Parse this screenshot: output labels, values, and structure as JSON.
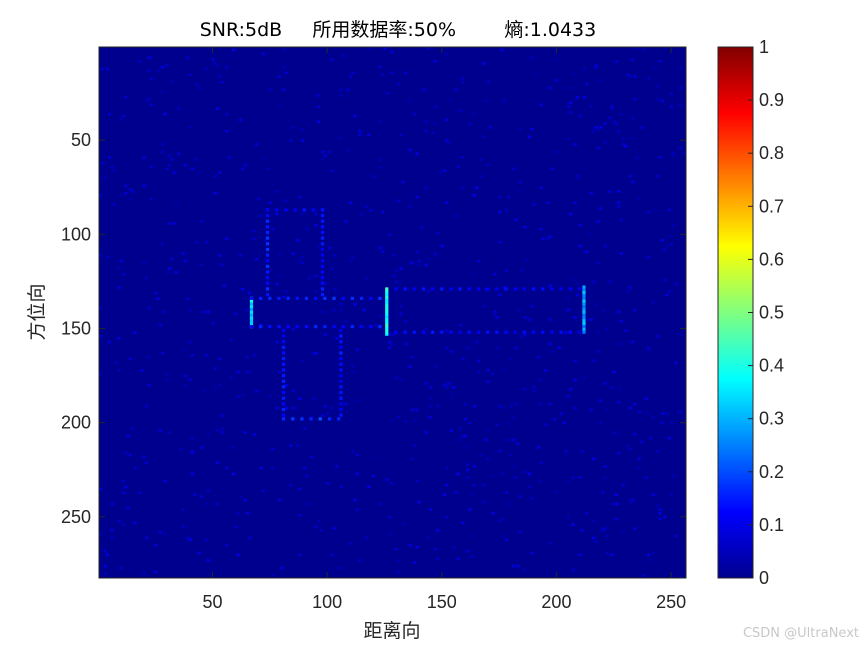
{
  "chart_data": {
    "type": "heatmap",
    "title": "SNR:5dB     所用数据率:50%        熵:1.0433",
    "xlabel": "距离向",
    "ylabel": "方位向",
    "xlim": [
      0.5,
      256.5
    ],
    "ylim": [
      0.5,
      282.5
    ],
    "y_reversed": true,
    "xticks": [
      50,
      100,
      150,
      200,
      250
    ],
    "yticks": [
      50,
      100,
      150,
      200,
      250
    ],
    "colormap": "jet",
    "background_color": "#00008f",
    "colorbar": {
      "range": [
        0,
        1
      ],
      "ticks": [
        0,
        0.1,
        0.2,
        0.3,
        0.4,
        0.5,
        0.6,
        0.7,
        0.8,
        0.9,
        1
      ]
    },
    "image_size": [
      256,
      282
    ],
    "scatterers": [
      {
        "x": 74,
        "y1": 87,
        "y2": 133,
        "value": 0.18
      },
      {
        "x": 98,
        "y1": 87,
        "y2": 133,
        "value": 0.16
      },
      {
        "x": 74,
        "y": 87,
        "x2": 98,
        "value": 0.15,
        "orientation": "h"
      },
      {
        "x": 67,
        "y1": 134,
        "y2": 150,
        "value": 0.4
      },
      {
        "x": 126,
        "y1": 129,
        "y2": 153,
        "value": 0.45
      },
      {
        "x": 212,
        "y1": 128,
        "y2": 152,
        "value": 0.33
      },
      {
        "x": 67,
        "y": 134,
        "x2": 126,
        "value": 0.18,
        "orientation": "h"
      },
      {
        "x": 67,
        "y": 149,
        "x2": 126,
        "value": 0.17,
        "orientation": "h"
      },
      {
        "x": 130,
        "y": 129,
        "x2": 212,
        "value": 0.15,
        "orientation": "h"
      },
      {
        "x": 130,
        "y": 152,
        "x2": 212,
        "value": 0.15,
        "orientation": "h"
      },
      {
        "x": 81,
        "y1": 151,
        "y2": 198,
        "value": 0.16
      },
      {
        "x": 106,
        "y1": 151,
        "y2": 198,
        "value": 0.16
      },
      {
        "x": 81,
        "y": 198,
        "x2": 106,
        "value": 0.22,
        "orientation": "h"
      }
    ]
  },
  "watermark": "CSDN @UltraNext"
}
